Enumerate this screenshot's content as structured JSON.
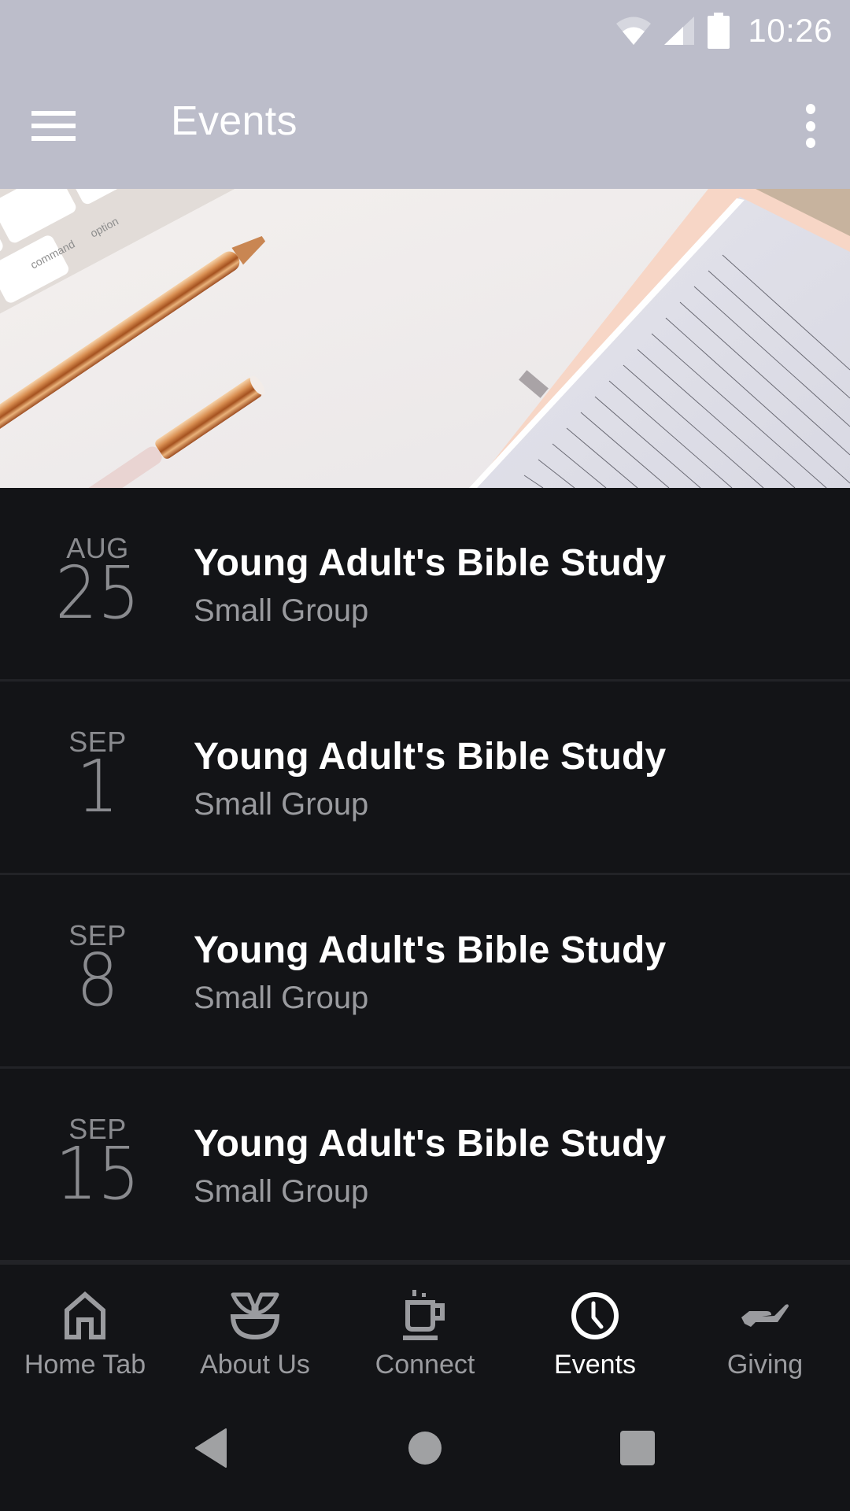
{
  "status_bar": {
    "time": "10:26",
    "icons": [
      "wifi-icon",
      "cell-signal-icon",
      "battery-icon"
    ]
  },
  "app_bar": {
    "title": "Events",
    "menu_icon": "hamburger-menu-icon",
    "overflow_icon": "more-vert-icon"
  },
  "banner": {
    "description": "Desk flat-lay: keyboard keys (command, option), rose-gold pens, lined notebook",
    "key_labels": [
      "command",
      "option"
    ]
  },
  "events": [
    {
      "month": "AUG",
      "day": "25",
      "title": "Young Adult's Bible Study",
      "subtitle": "Small Group"
    },
    {
      "month": "SEP",
      "day": "1",
      "title": "Young Adult's Bible Study",
      "subtitle": "Small Group"
    },
    {
      "month": "SEP",
      "day": "8",
      "title": "Young Adult's Bible Study",
      "subtitle": "Small Group"
    },
    {
      "month": "SEP",
      "day": "15",
      "title": "Young Adult's Bible Study",
      "subtitle": "Small Group"
    }
  ],
  "tabs": [
    {
      "label": "Home Tab",
      "icon": "home-icon",
      "active": false
    },
    {
      "label": "About Us",
      "icon": "plant-bowl-icon",
      "active": false
    },
    {
      "label": "Connect",
      "icon": "coffee-cup-icon",
      "active": false
    },
    {
      "label": "Events",
      "icon": "clock-icon",
      "active": true
    },
    {
      "label": "Giving",
      "icon": "giving-hand-icon",
      "active": false
    }
  ],
  "system_nav": {
    "back": "back-icon",
    "home": "home-circle-icon",
    "recents": "recents-square-icon"
  },
  "colors": {
    "app_bar_bg": "#bcbdca",
    "list_bg": "#131417",
    "divider": "#222327",
    "text_primary": "#ffffff",
    "text_secondary": "#9a9b9f",
    "icon_inactive": "#9a9b9f"
  }
}
